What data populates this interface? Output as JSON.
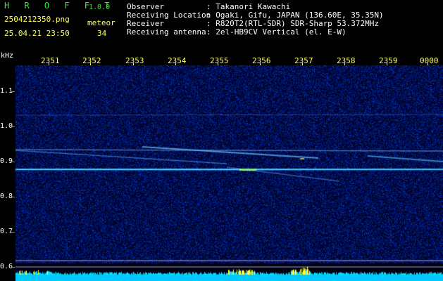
{
  "app": {
    "name": "H R O F F T",
    "version": "1.0.0"
  },
  "file": {
    "name": "2504212350.png",
    "datetime": "25.04.21 23:50"
  },
  "meteor": {
    "label": "meteor",
    "count": "34"
  },
  "station": {
    "observer_label": "Observer",
    "observer_value": ": Takanori Kawachi",
    "location_label": "Receiving Location",
    "location_value": ": Ogaki, Gifu, JAPAN (136.60E, 35.35N)",
    "receiver_label": "Receiver",
    "receiver_value": ": R820T2(RTL-SDR) SDR-Sharp 53.372MHz",
    "antenna_label": "Receiving antenna",
    "antenna_value": ": 2el-HB9CV Vertical (el. E-W)"
  },
  "axis": {
    "unit": "kHz",
    "y_ticks": [
      "1.1",
      "1.0",
      "0.9",
      "0.8",
      "0.7",
      "0.6"
    ],
    "x_ticks": [
      "2351",
      "2352",
      "2353",
      "2354",
      "2355",
      "2356",
      "2357",
      "2358",
      "2359",
      "0000"
    ]
  },
  "colors": {
    "background": "#000000",
    "header_green": "#39e639",
    "header_yellow": "#ffff66",
    "baseline": "#00ffff"
  }
}
